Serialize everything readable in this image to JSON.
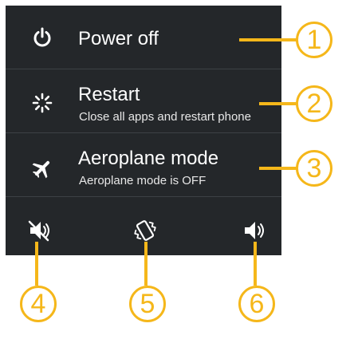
{
  "menu": {
    "power_off": {
      "label": "Power off",
      "icon": "power-icon"
    },
    "restart": {
      "label": "Restart",
      "subtitle": "Close all apps and restart phone",
      "icon": "restart-icon"
    },
    "aeroplane": {
      "label": "Aeroplane mode",
      "subtitle": "Aeroplane mode is OFF",
      "icon": "airplane-icon"
    }
  },
  "sound_modes": [
    {
      "name": "mute",
      "icon": "mute-icon"
    },
    {
      "name": "vibrate",
      "icon": "vibrate-icon"
    },
    {
      "name": "sound",
      "icon": "sound-icon"
    }
  ],
  "callouts": [
    "1",
    "2",
    "3",
    "4",
    "5",
    "6"
  ],
  "colors": {
    "panel": "#24272a",
    "divider": "#3d4145",
    "text": "#ffffff",
    "callout": "#f5b71a"
  }
}
